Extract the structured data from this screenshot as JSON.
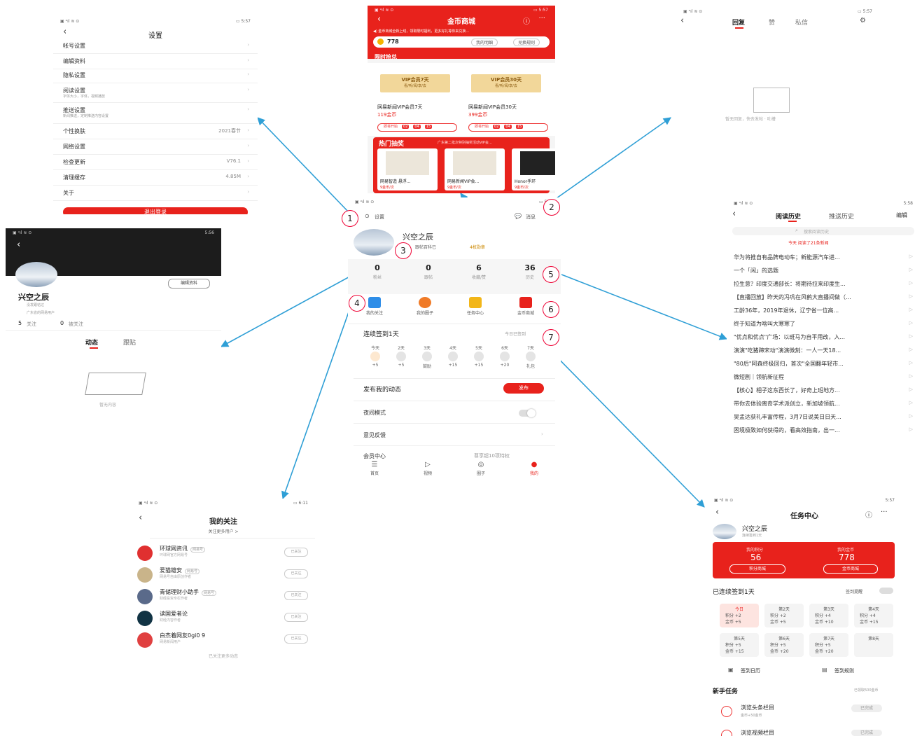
{
  "callouts": [
    "1",
    "2",
    "3",
    "4",
    "5",
    "6",
    "7"
  ],
  "settings": {
    "status_left": "▣ ᵊıl ≋ ⊙",
    "status_right": "▭ 5:57",
    "title": "设置",
    "rows": [
      {
        "label": "帐号设置",
        "sub": "",
        "value": ""
      },
      {
        "label": "编辑资料",
        "sub": "",
        "value": ""
      },
      {
        "label": "隐私设置",
        "sub": "",
        "value": ""
      },
      {
        "label": "阅读设置",
        "sub": "字体大小，字体，视频播放",
        "value": ""
      },
      {
        "label": "推送设置",
        "sub": "新闻推送，定制推送内容设置",
        "value": ""
      },
      {
        "label": "个性换肤",
        "sub": "",
        "value": "2021春节"
      },
      {
        "label": "网络设置",
        "sub": "",
        "value": ""
      },
      {
        "label": "检查更新",
        "sub": "",
        "value": "V76.1"
      },
      {
        "label": "清理缓存",
        "sub": "",
        "value": "4.85M"
      },
      {
        "label": "关于",
        "sub": "",
        "value": ""
      }
    ],
    "logout": "退出登录"
  },
  "mall": {
    "title": "金币商城",
    "notice": "◀) 金币商城全新上线，领取限时福利，更多好礼等你来兑换...",
    "coins": "778",
    "btn_detail": "我的明细",
    "btn_rule": "兑换规则",
    "section_flash": "限时抢兑",
    "products": [
      {
        "card": "VIP会员7天",
        "card_sub": "看/听/阅/享/去",
        "name": "网易新闻VIP会员7天",
        "price": "119金币",
        "tag": "即将开始"
      },
      {
        "card": "VIP会员30天",
        "card_sub": "看/听/阅/享/去",
        "name": "网易新闻VIP会员30天",
        "price": "399金币",
        "tag": "即将开始"
      }
    ],
    "countdown": [
      "02",
      "04",
      "15"
    ],
    "section_lottery": "热门抽奖",
    "lottery_note": "广东第二批次特别抽奖活动VIP会...",
    "lottery": [
      {
        "name": "网易智造 悬浮...",
        "price": "9金币/次"
      },
      {
        "name": "网易新闻VIP会...",
        "price": "9金币/次"
      },
      {
        "name": "Honor手环",
        "price": "9金币/次"
      }
    ]
  },
  "messages": {
    "tabs": [
      "回复",
      "赞",
      "私信"
    ],
    "empty": "暂无回复，快去发帖 · 吐槽"
  },
  "profile_home": {
    "settings_label": "设置",
    "message_label": "消息",
    "username": "兴空之辰",
    "badge1": "跟帖百科已",
    "badge2": "4枚勋章",
    "stats": [
      {
        "num": "0",
        "label": "粉丝"
      },
      {
        "num": "0",
        "label": "跟帖"
      },
      {
        "num": "6",
        "label": "收藏/赞"
      },
      {
        "num": "36",
        "label": "历史"
      }
    ],
    "shortcuts": [
      "我的关注",
      "我的圈子",
      "任务中心",
      "金币商城"
    ],
    "checkin_title": "连续签到1天",
    "checkin_status": "今日已签到",
    "days": [
      {
        "d": "今天",
        "v": "+5"
      },
      {
        "d": "2天",
        "v": "+5"
      },
      {
        "d": "3天",
        "v": "鼓励"
      },
      {
        "d": "4天",
        "v": "+15"
      },
      {
        "d": "5天",
        "v": "+15"
      },
      {
        "d": "6天",
        "v": "+20"
      },
      {
        "d": "7天",
        "v": "礼包"
      }
    ],
    "post_label": "发布我的动态",
    "post_btn": "发布",
    "night_mode": "夜间模式",
    "feedback": "意见反馈",
    "vip": "会员中心",
    "vip_note": "尊享超10项特权",
    "nav": [
      "首页",
      "视频",
      "圈子",
      "我的"
    ]
  },
  "user_profile": {
    "status_right": "5:56",
    "edit_btn": "编辑资料",
    "name": "兴空之辰",
    "line1": "没发跟帖过",
    "line2": "广东省的网易用户",
    "following": "5",
    "following_label": "关注",
    "followers": "0",
    "followers_label": "被关注",
    "tabs": [
      "动态",
      "跟贴"
    ],
    "empty": "暂无内容"
  },
  "history": {
    "status_right": "5:58",
    "tabs": [
      "阅读历史",
      "推送历史"
    ],
    "edit": "编辑",
    "search": "搜索阅读历史",
    "today_note": "今天 阅读了21条新闻",
    "items": [
      "华为将推自有品牌电动车；新能源汽车进...",
      "一个「闲」的选题",
      "拉生意？印度交通部长：将期待拉来印度生...",
      "【直播回放】昨天的冯巩在风鹤大直播间做（...",
      "工龄36年，2019年退休，辽宁省一位高...",
      "终于知道为啥叫大寒寒了",
      "\"优点和优点\"广场：以斑马为自平用改，入...",
      "演演\"吃猪蹄宋动\"演演微刻：一人一天18...",
      "\"80后\"阿森终极回归，首次\"全国翻年轻市...",
      "微短剧｜领航新征程",
      "【核心】相子这东西长了，好奇上班地方...",
      "带你去体验离奇学术派创立，新加坡领航...",
      "吴孟达获礼丰富传程，3月7日说美日日天...",
      "困境极致如何获得的，看高效指南，出一..."
    ]
  },
  "following": {
    "title": "我的关注",
    "sub": "关注更多用户 >",
    "items": [
      {
        "name": "环球网资讯",
        "tag": "网易号",
        "desc": "环球网官方网易号",
        "btn": "已关注",
        "color": "#e03030"
      },
      {
        "name": "爱猫雄安",
        "tag": "网易号",
        "desc": "网易号自由原创作者",
        "btn": "已关注",
        "color": "#c9b48a"
      },
      {
        "name": "青储理财小助手",
        "tag": "网易号",
        "desc": "财经投资专栏作者",
        "btn": "已关注",
        "color": "#5a6a8a"
      },
      {
        "name": "读国爱者论",
        "tag": "",
        "desc": "财经内容作者",
        "btn": "已关注",
        "color": "#113344"
      },
      {
        "name": "白杰着网友0gi0 9",
        "tag": "",
        "desc": "网易新闻用户",
        "btn": "已关注",
        "color": "#e04040"
      }
    ],
    "more": "已关注更多动态"
  },
  "tasks": {
    "status_right": "5:57",
    "title": "任务中心",
    "name": "兴空之辰",
    "sub": "连续签到1天",
    "points_label": "我的积分",
    "points": "56",
    "points_btn": "积分商城",
    "coins_label": "我的金币",
    "coins": "778",
    "coins_btn": "金币商城",
    "checkin": "已连续签到1天",
    "remind": "签到提醒",
    "grid": [
      {
        "d": "今日",
        "a": "积分 +2",
        "b": "金币 +5"
      },
      {
        "d": "第2天",
        "a": "积分 +2",
        "b": "金币 +5"
      },
      {
        "d": "第3天",
        "a": "积分 +4",
        "b": "金币 +10"
      },
      {
        "d": "第4天",
        "a": "积分 +4",
        "b": "金币 +15"
      },
      {
        "d": "第5天",
        "a": "积分 +5",
        "b": "金币 +15"
      },
      {
        "d": "第6天",
        "a": "积分 +5",
        "b": "金币 +20"
      },
      {
        "d": "第7天",
        "a": "积分 +5",
        "b": "金币 +20"
      },
      {
        "d": "第8天",
        "a": "",
        "b": ""
      }
    ],
    "calendar": "签到日历",
    "rules": "签到规则",
    "newbie": "新手任务",
    "newbie_note": "已领取500金币",
    "task1": "浏览头条栏目",
    "task1_sub": "金币+50金币",
    "task1_btn": "已完成",
    "task2": "浏览视频栏目",
    "task2_btn": "已完成"
  },
  "colors": {
    "accent": "#e8221c",
    "arrow": "#2f9fd6"
  }
}
